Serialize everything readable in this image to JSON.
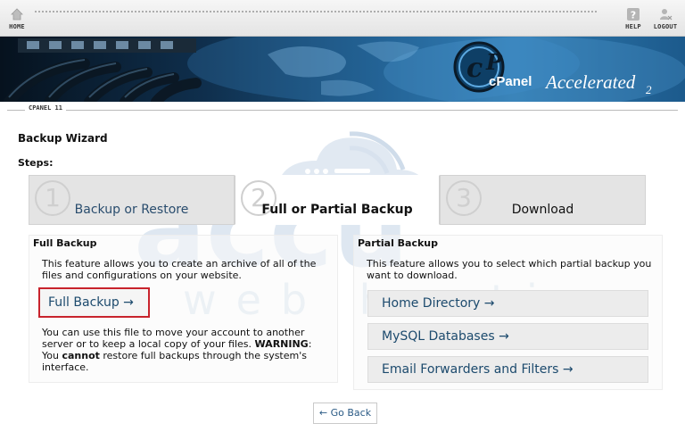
{
  "nav": {
    "home": "HOME",
    "help": "HELP",
    "logout": "LOGOUT"
  },
  "banner": {
    "logo_text": "cPanel",
    "logo_accelerated": "Accelerated",
    "logo_version": "2"
  },
  "strip": {
    "label": "CPANEL 11"
  },
  "page": {
    "title": "Backup Wizard",
    "steps_label": "Steps:"
  },
  "steps": [
    {
      "number": "1",
      "label": "Backup or Restore"
    },
    {
      "number": "2",
      "label": "Full or Partial Backup"
    },
    {
      "number": "3",
      "label": "Download"
    }
  ],
  "full": {
    "heading": "Full Backup",
    "desc": "This feature allows you to create an archive of all of the files and configurations on your website.",
    "button": "Full Backup →",
    "note_a": "You can use this file to move your account to another server or to keep a local copy of your files. ",
    "note_warning": "WARNING",
    "note_b": ": You ",
    "note_cannot": "cannot",
    "note_c": " restore full backups through the system's interface."
  },
  "partial": {
    "heading": "Partial Backup",
    "desc": "This feature allows you to select which partial backup you want to download.",
    "options": [
      "Home Directory →",
      "MySQL Databases →",
      "Email Forwarders and Filters →"
    ]
  },
  "go_back": "← Go Back",
  "watermark": {
    "line1": "accu",
    "line2": "web hosting"
  },
  "colors": {
    "accent_red": "#c8232c",
    "link_blue": "#1c4a6d",
    "banner_blue": "#1b5583"
  }
}
